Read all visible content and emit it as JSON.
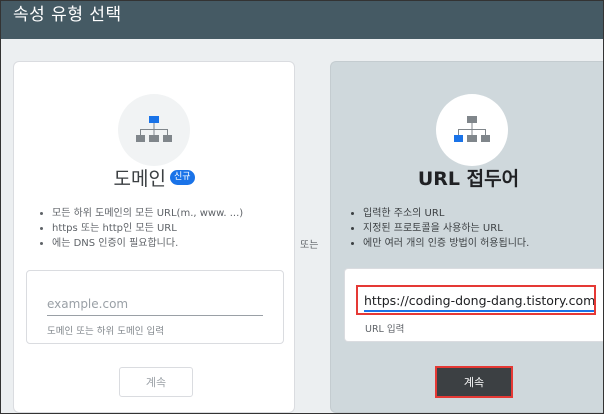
{
  "header": {
    "title": "속성 유형 선택"
  },
  "domain_card": {
    "title": "도메인",
    "badge": "신규",
    "bullets": [
      "모든 하위 도메인의 모든 URL(m., www. ...)",
      "https 또는 http인 모든 URL",
      "에는 DNS 인증이 필요합니다."
    ],
    "input_placeholder": "example.com",
    "helper": "도메인 또는 하위 도메인 입력",
    "continue_label": "계속"
  },
  "or_label": "또는",
  "url_card": {
    "title": "URL 접두어",
    "bullets": [
      "입력한 주소의 URL",
      "지정된 프로토콜을 사용하는 URL",
      "에만 여러 개의 인증 방법이 허용됩니다."
    ],
    "input_value": "https://coding-dong-dang.tistory.com",
    "helper": "URL 입력",
    "continue_label": "계속"
  },
  "colors": {
    "header_bg": "#455a64",
    "accent": "#1a73e8",
    "highlight": "#e53935",
    "selected_card_bg": "#cfd8dc"
  }
}
